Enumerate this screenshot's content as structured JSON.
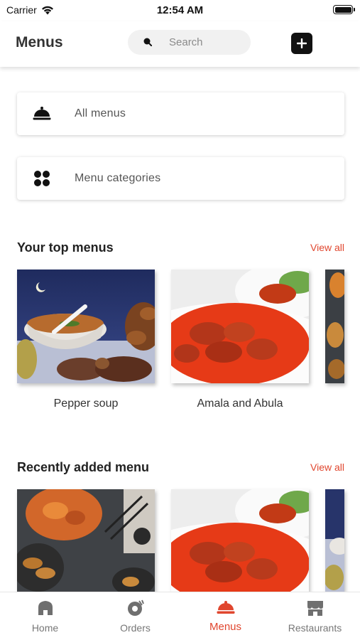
{
  "status_bar": {
    "carrier": "Carrier",
    "time": "12:54 AM"
  },
  "header": {
    "title": "Menus",
    "search_placeholder": "Search"
  },
  "nav_cards": [
    {
      "label": "All menus",
      "icon": "cloche-icon"
    },
    {
      "label": "Menu categories",
      "icon": "grid-icon"
    }
  ],
  "top_menus": {
    "title": "Your top menus",
    "view_all": "View all",
    "items": [
      {
        "name": "Pepper soup"
      },
      {
        "name": "Amala and Abula"
      }
    ]
  },
  "recent_menus": {
    "title": "Recently added menu",
    "view_all": "View all"
  },
  "tab_bar": {
    "tabs": [
      {
        "label": "Home",
        "icon": "home-icon"
      },
      {
        "label": "Orders",
        "icon": "orders-icon"
      },
      {
        "label": "Menus",
        "icon": "cloche-icon"
      },
      {
        "label": "Restaurants",
        "icon": "store-icon"
      }
    ],
    "active_index": 2
  },
  "colors": {
    "accent": "#e0462e",
    "text_primary": "#222222",
    "text_secondary": "#555555"
  }
}
